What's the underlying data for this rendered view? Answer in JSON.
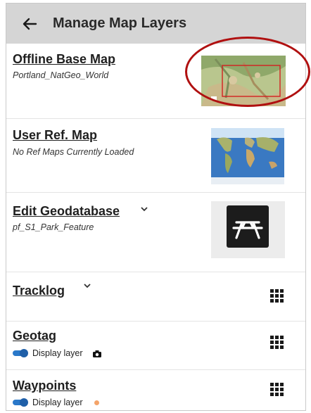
{
  "header": {
    "title": "Manage Map Layers",
    "back_icon": "arrow-left-icon"
  },
  "layers": {
    "offline_base_map": {
      "title": "Offline Base Map",
      "subtitle": "Portland_NatGeo_World"
    },
    "user_ref_map": {
      "title": "User Ref. Map",
      "subtitle": "No Ref Maps Currently Loaded"
    },
    "edit_geodatabase": {
      "title": "Edit Geodatabase",
      "subtitle": "pf_S1_Park_Feature",
      "icon": "picnic-table-icon"
    },
    "tracklog": {
      "title": "Tracklog"
    },
    "geotag": {
      "title": "Geotag",
      "display_label": "Display layer",
      "icon": "camera-icon"
    },
    "waypoints": {
      "title": "Waypoints",
      "display_label": "Display layer",
      "dot_color": "#f4a46a"
    }
  },
  "colors": {
    "header_bg": "#d5d5d5",
    "toggle_blue": "#2a78c9",
    "annotation_red": "#b01010"
  }
}
